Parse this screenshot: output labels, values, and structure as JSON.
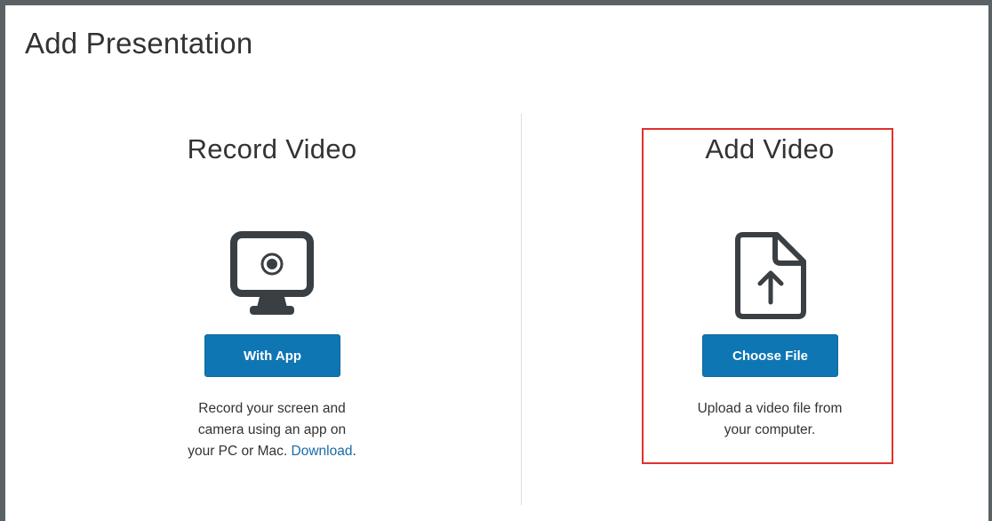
{
  "page": {
    "title": "Add Presentation"
  },
  "record": {
    "title": "Record Video",
    "icon": "monitor-record-icon",
    "button_label": "With App",
    "description_line1": "Record your screen and",
    "description_line2": "camera using an app on",
    "description_line3": "your PC or Mac.",
    "download_link": "Download",
    "description_end": "."
  },
  "upload": {
    "title": "Add Video",
    "icon": "file-upload-icon",
    "button_label": "Choose File",
    "description_line1": "Upload a video file from",
    "description_line2": "your computer."
  },
  "colors": {
    "button_bg": "#0e76b3",
    "link": "#1a6aa6",
    "highlight_border": "#e0312c",
    "frame_border": "#5b6266",
    "icon": "#3a3f44"
  }
}
